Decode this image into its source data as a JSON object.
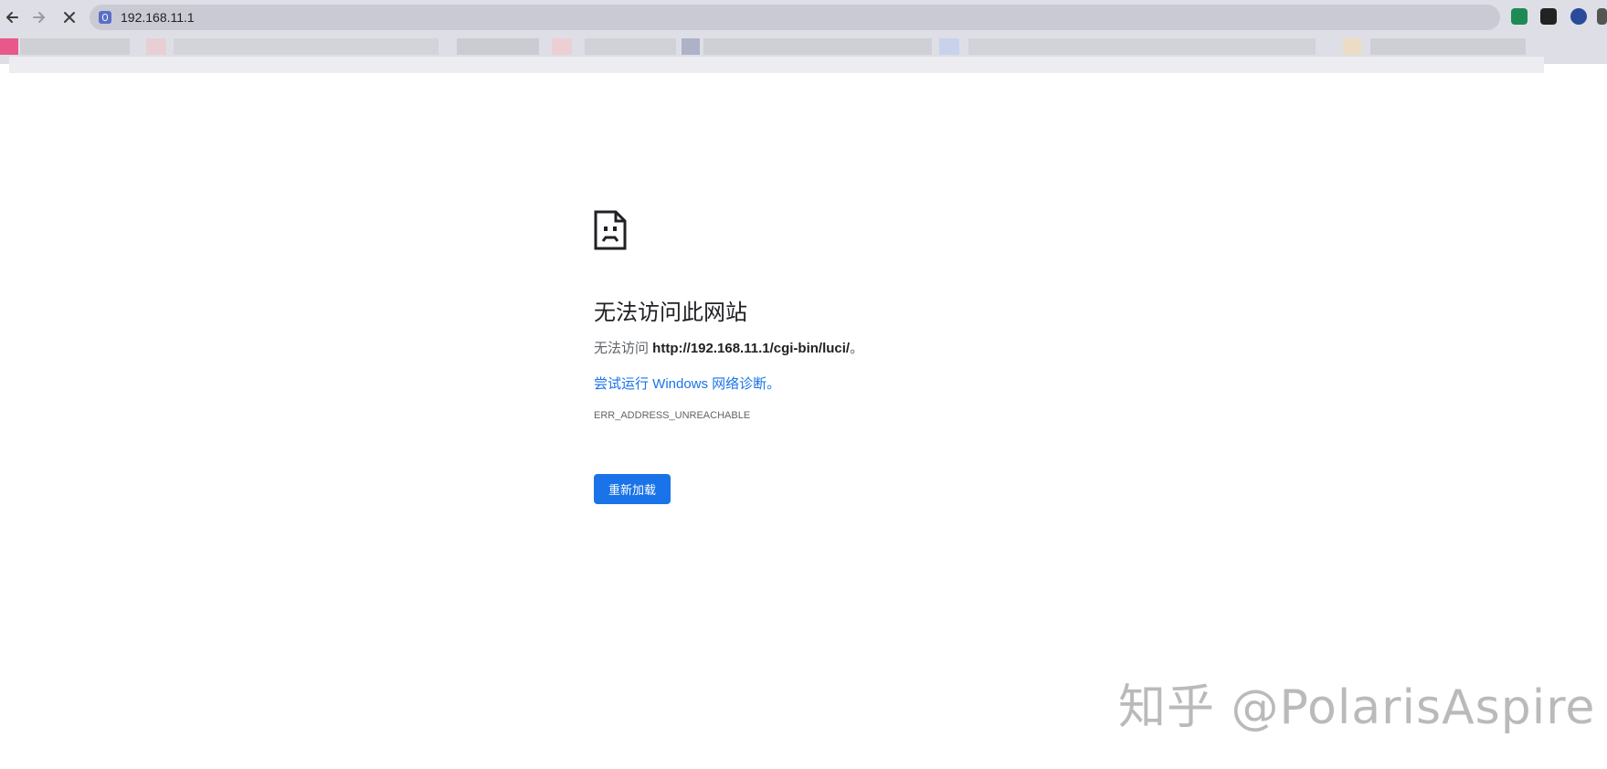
{
  "browser": {
    "address_bar": {
      "url": "192.168.11.1"
    },
    "icons": {
      "back": "arrow-left-icon",
      "forward": "arrow-right-icon",
      "stop": "close-icon",
      "site": "site-favicon-icon"
    },
    "colors": {
      "chrome_bg": "#dedfe6",
      "omnibox_bg": "#c9cad4"
    }
  },
  "error_page": {
    "icon": "sad-page-icon",
    "title": "无法访问此网站",
    "description_prefix": "无法访问 ",
    "description_url": "http://192.168.11.1/cgi-bin/luci/",
    "description_suffix": "。",
    "diagnostics_link": "尝试运行 Windows 网络诊断。",
    "error_code": "ERR_ADDRESS_UNREACHABLE",
    "reload_button": "重新加载",
    "colors": {
      "link": "#1a73e8",
      "button_bg": "#1a73e8",
      "button_text": "#ffffff"
    }
  },
  "watermark": {
    "text": "知乎 @PolarisAspire"
  }
}
